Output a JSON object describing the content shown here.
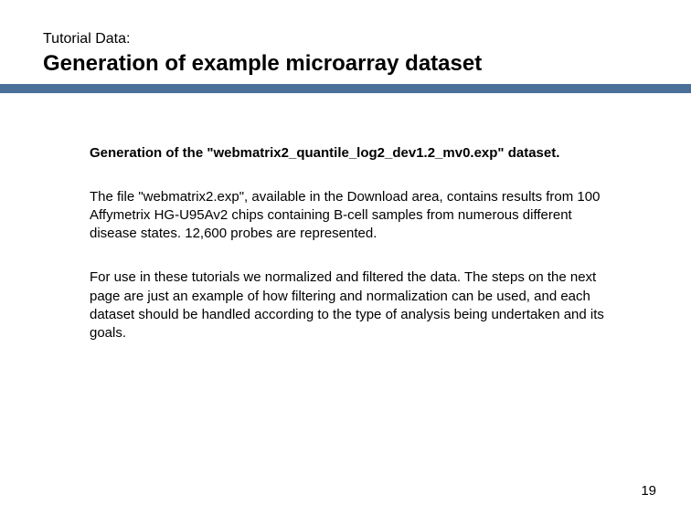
{
  "header": {
    "pretitle": "Tutorial Data:",
    "title": "Generation of example microarray dataset"
  },
  "content": {
    "subheading": "Generation of the \"webmatrix2_quantile_log2_dev1.2_mv0.exp\" dataset.",
    "para1": "The file \"webmatrix2.exp\", available in the Download area, contains results from 100 Affymetrix HG-U95Av2 chips containing B-cell samples from numerous different disease states. 12,600 probes are represented.",
    "para2": "For use in these tutorials we normalized and filtered the data. The steps on the next page are just an example of how filtering and normalization can be used, and each dataset should be handled according to the type of analysis being undertaken and its goals."
  },
  "pagenum": "19",
  "colors": {
    "rule": "#4a6f99"
  }
}
